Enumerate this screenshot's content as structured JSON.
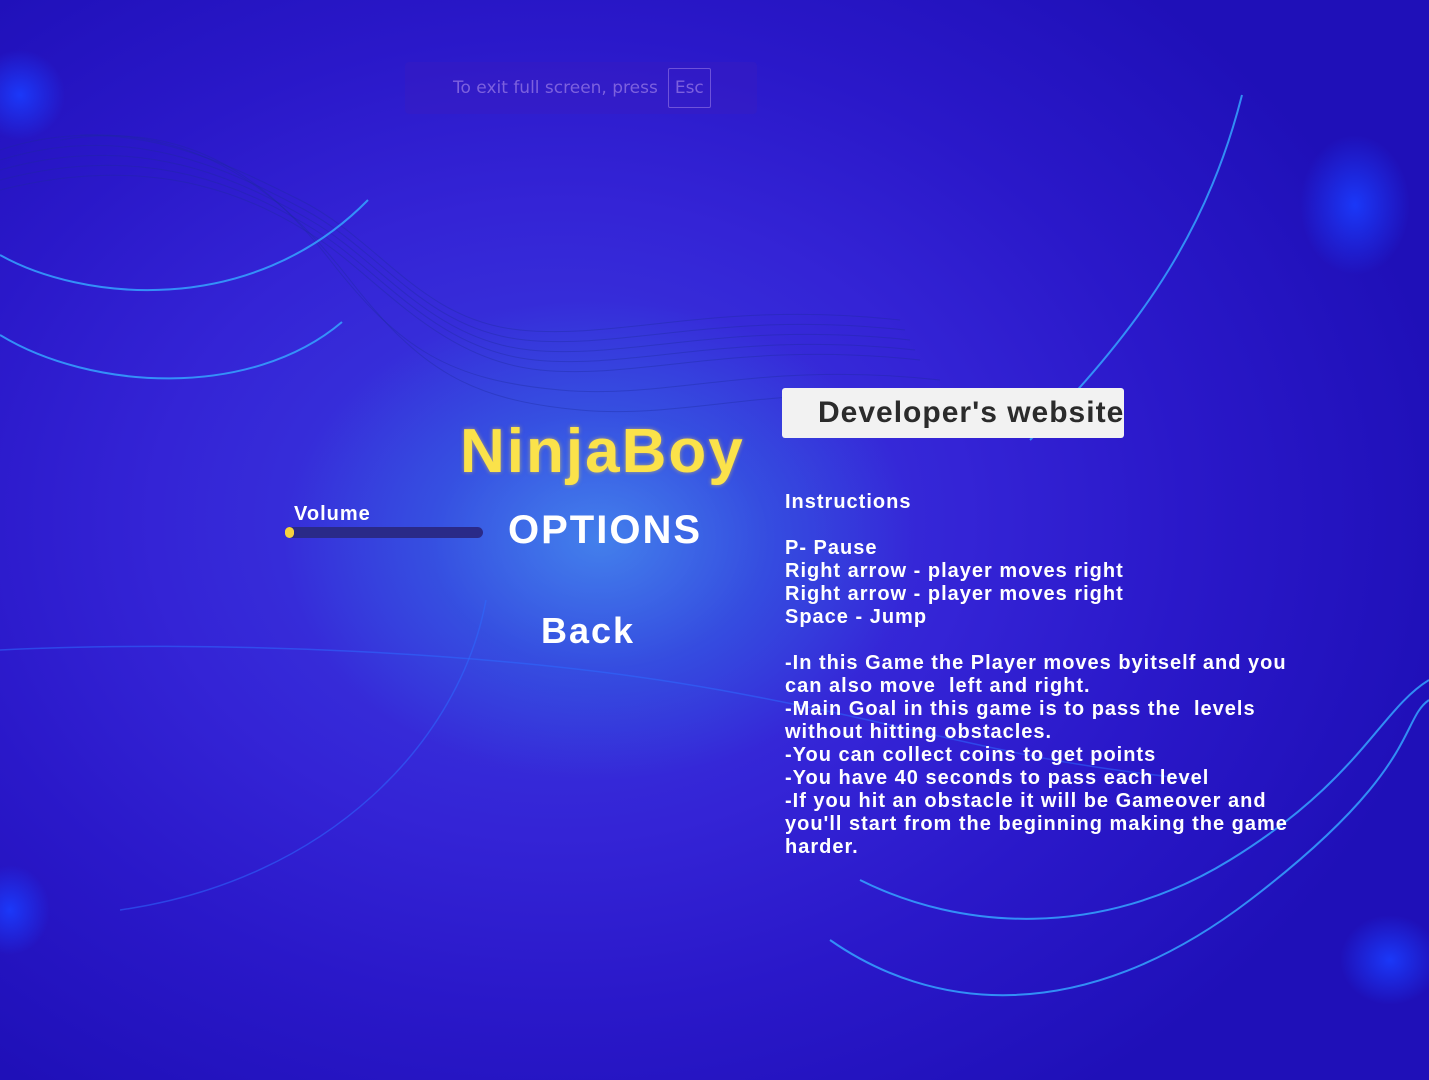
{
  "fullscreen_hint": {
    "message": "To exit full screen, press",
    "key": "Esc"
  },
  "developer_button": {
    "label": "Developer's website"
  },
  "title": {
    "game_name": "NinjaBoy",
    "screen_name": "OPTIONS"
  },
  "volume": {
    "label": "Volume",
    "level": 0.0
  },
  "back_button": {
    "label": "Back"
  },
  "instructions": {
    "lines": [
      "Instructions",
      "",
      "P- Pause",
      "Right arrow - player moves right",
      "Right arrow - player moves right",
      "Space - Jump",
      "",
      "-In this Game the Player moves byitself and you",
      "can also move  left and right.",
      "-Main Goal in this game is to pass the  levels",
      "without hitting obstacles.",
      "-You can collect coins to get points",
      "-You have 40 seconds to pass each level",
      "-If you hit an obstacle it will be Gameover and",
      "you'll start from the beginning making the game",
      "harder."
    ]
  },
  "colors": {
    "title_yellow": "#fbe24a",
    "background_blue": "#3424d6",
    "button_bg": "#f2f2f2",
    "slider_fill": "#f6d23e"
  }
}
